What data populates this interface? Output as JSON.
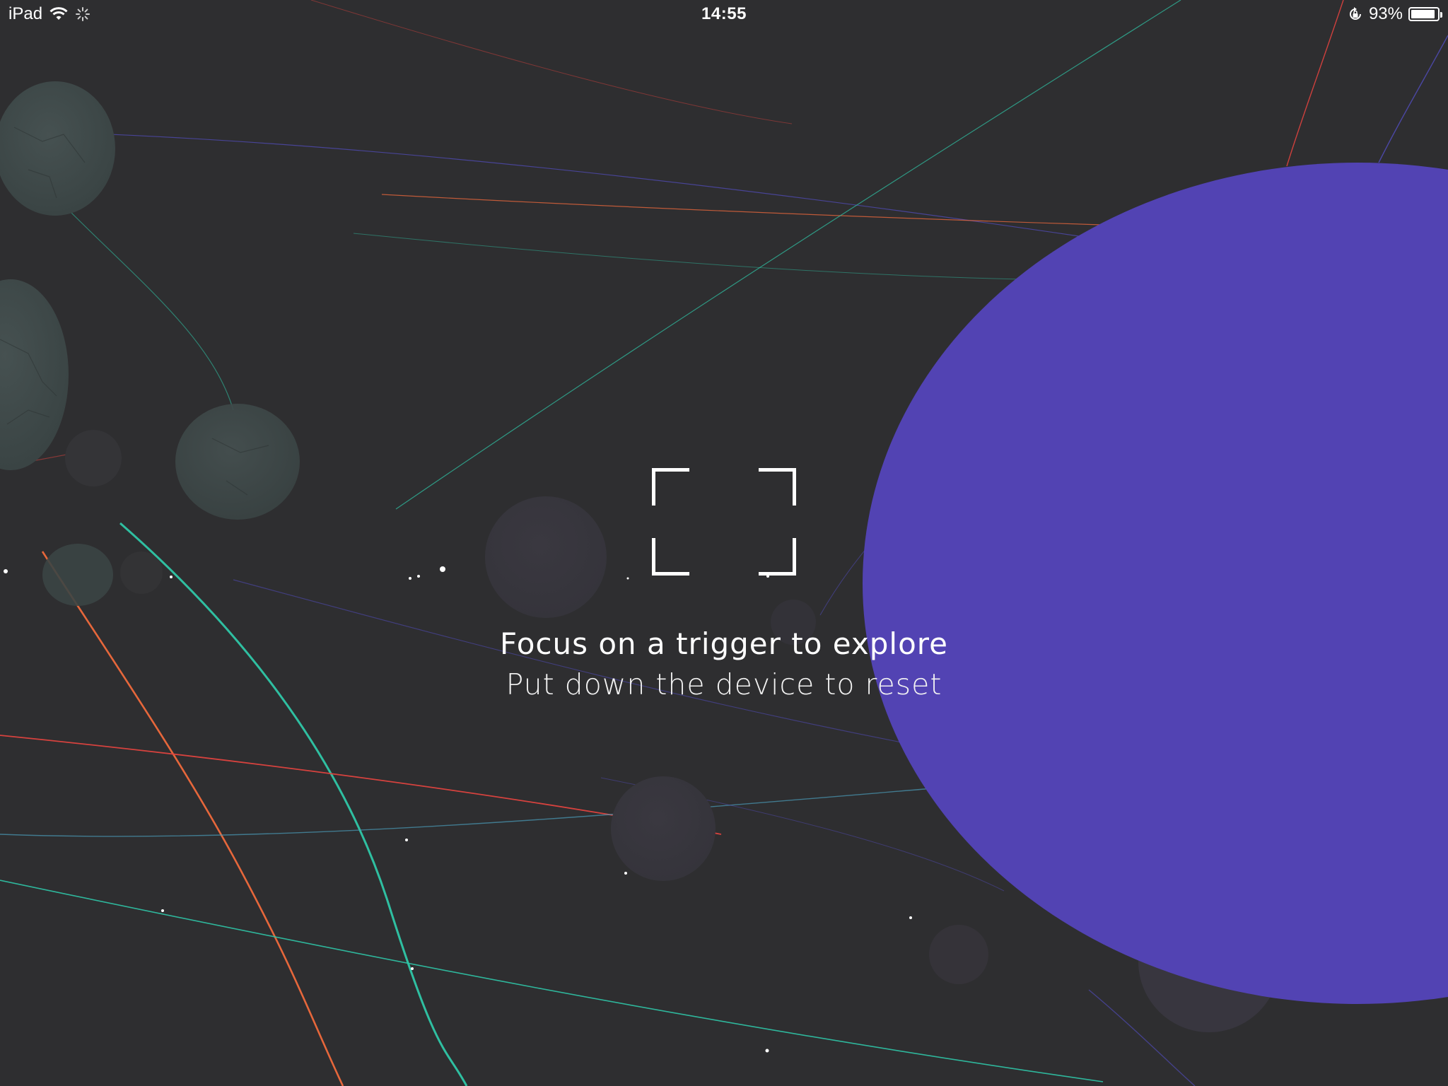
{
  "status_bar": {
    "device": "iPad",
    "time": "14:55",
    "battery_percent": "93%",
    "battery_level": 0.93,
    "icons": [
      "wifi-icon",
      "activity-spinner-icon",
      "rotation-lock-icon",
      "battery-icon"
    ]
  },
  "scanner": {
    "frame_icon": "viewfinder-icon",
    "title": "Focus on a trigger to explore",
    "subtitle": "Put down the device to reset"
  },
  "colors": {
    "background": "#2e2e30",
    "planet_purple": "#5243b3",
    "teal": "#2fc7a8",
    "orange": "#f06a3c",
    "red": "#e0433f",
    "blue": "#4f4ab0",
    "grey_planet": "#3f4a4a"
  }
}
